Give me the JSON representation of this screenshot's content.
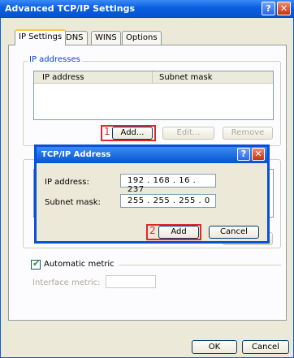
{
  "window": {
    "title": "Advanced TCP/IP Settings",
    "help_glyph": "?",
    "close_glyph": "✕"
  },
  "tabs": [
    {
      "label": "IP Settings"
    },
    {
      "label": "DNS"
    },
    {
      "label": "WINS"
    },
    {
      "label": "Options"
    }
  ],
  "ip_addresses": {
    "group_label": "IP addresses",
    "columns": [
      "IP address",
      "Subnet mask"
    ],
    "step_label": "1",
    "add_label": "Add...",
    "edit_label": "Edit...",
    "remove_label": "Remove"
  },
  "dialog": {
    "title": "TCP/IP Address",
    "help_glyph": "?",
    "close_glyph": "✕",
    "ip_label": "IP address:",
    "ip_value": "192 . 168 . 16 . 237",
    "mask_label": "Subnet mask:",
    "mask_value": "255 . 255 . 255 . 0",
    "step_label": "2",
    "add_label": "Add",
    "cancel_label": "Cancel"
  },
  "metric": {
    "auto_label": "Automatic metric",
    "auto_checked": true,
    "interface_label": "Interface metric:"
  },
  "footer": {
    "ok_label": "OK",
    "cancel_label": "Cancel"
  }
}
